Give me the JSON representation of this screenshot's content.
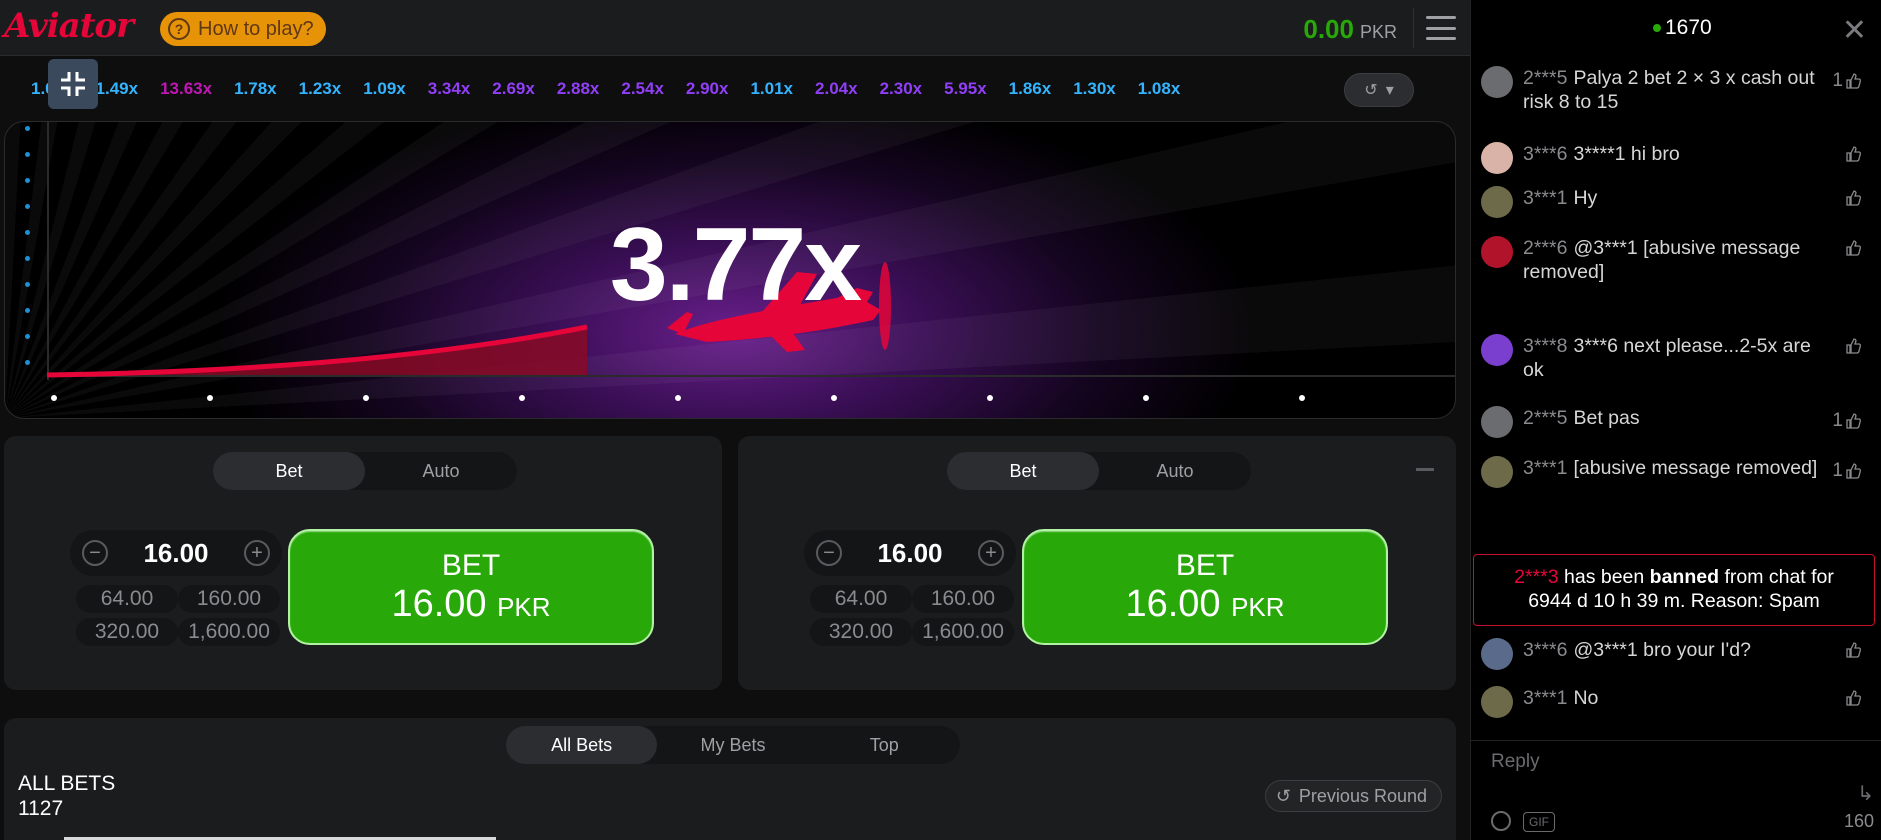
{
  "header": {
    "logo": "Aviator",
    "how_to_play": "How to play?",
    "balance_amount": "0.00",
    "balance_currency": "PKR",
    "menu_icon": "hamburger-menu-icon"
  },
  "history": [
    "1.05x",
    "1.49x",
    "13.63x",
    "1.78x",
    "1.23x",
    "1.09x",
    "3.34x",
    "2.69x",
    "2.88x",
    "2.54x",
    "2.90x",
    "1.01x",
    "2.04x",
    "2.30x",
    "5.95x",
    "1.86x",
    "1.30x",
    "1.08x"
  ],
  "history_colors": [
    "blue",
    "blue",
    "pink",
    "blue",
    "blue",
    "blue",
    "purple",
    "purple",
    "purple",
    "purple",
    "purple",
    "blue",
    "purple",
    "purple",
    "purple",
    "blue",
    "blue",
    "blue"
  ],
  "game": {
    "multiplier": "3.77x",
    "flight_progress": 0.46,
    "colors": {
      "curve": "#e50539",
      "plane": "#e50539",
      "bg": "#3b0f57"
    }
  },
  "bet_panels": [
    {
      "tab_bet": "Bet",
      "tab_auto": "Auto",
      "amount": "16.00",
      "quick": [
        "64.00",
        "160.00",
        "320.00",
        "1,600.00"
      ],
      "button_line1": "BET",
      "button_amount": "16.00",
      "button_currency": "PKR"
    },
    {
      "tab_bet": "Bet",
      "tab_auto": "Auto",
      "amount": "16.00",
      "quick": [
        "64.00",
        "160.00",
        "320.00",
        "1,600.00"
      ],
      "button_line1": "BET",
      "button_amount": "16.00",
      "button_currency": "PKR"
    }
  ],
  "bets": {
    "tabs": [
      "All Bets",
      "My Bets",
      "Top"
    ],
    "title": "ALL BETS",
    "count": "1127",
    "previous_round": "Previous Round"
  },
  "chat": {
    "online": "1670",
    "messages": [
      {
        "user": "2***5",
        "text": "Palya 2 bet 2 × 3 x cash out risk 8 to 15",
        "likes": "1"
      },
      {
        "user": "3***6",
        "text": "3****1 hi bro",
        "likes": ""
      },
      {
        "user": "3***1",
        "text": "Hy",
        "likes": ""
      },
      {
        "user": "2***6",
        "text": "@3***1 [abusive message removed]",
        "likes": ""
      },
      {
        "user": "3***8",
        "text": "3***6 next please...2-5x are ok",
        "likes": ""
      },
      {
        "user": "2***5",
        "text": "Bet pas",
        "likes": "1"
      },
      {
        "user": "3***1",
        "text": "[abusive message removed]",
        "likes": "1"
      },
      {
        "user": "3***6",
        "text": "@3***1 bro your I'd?",
        "likes": ""
      },
      {
        "user": "3***1",
        "text": "No",
        "likes": ""
      }
    ],
    "ban": {
      "user": "2***3",
      "pre": "has been",
      "word": "banned",
      "post": "from chat for",
      "line2": "6944 d 10 h 39 m. Reason: Spam"
    },
    "reply_placeholder": "Reply",
    "gif_label": "GIF",
    "char_count": "160"
  }
}
